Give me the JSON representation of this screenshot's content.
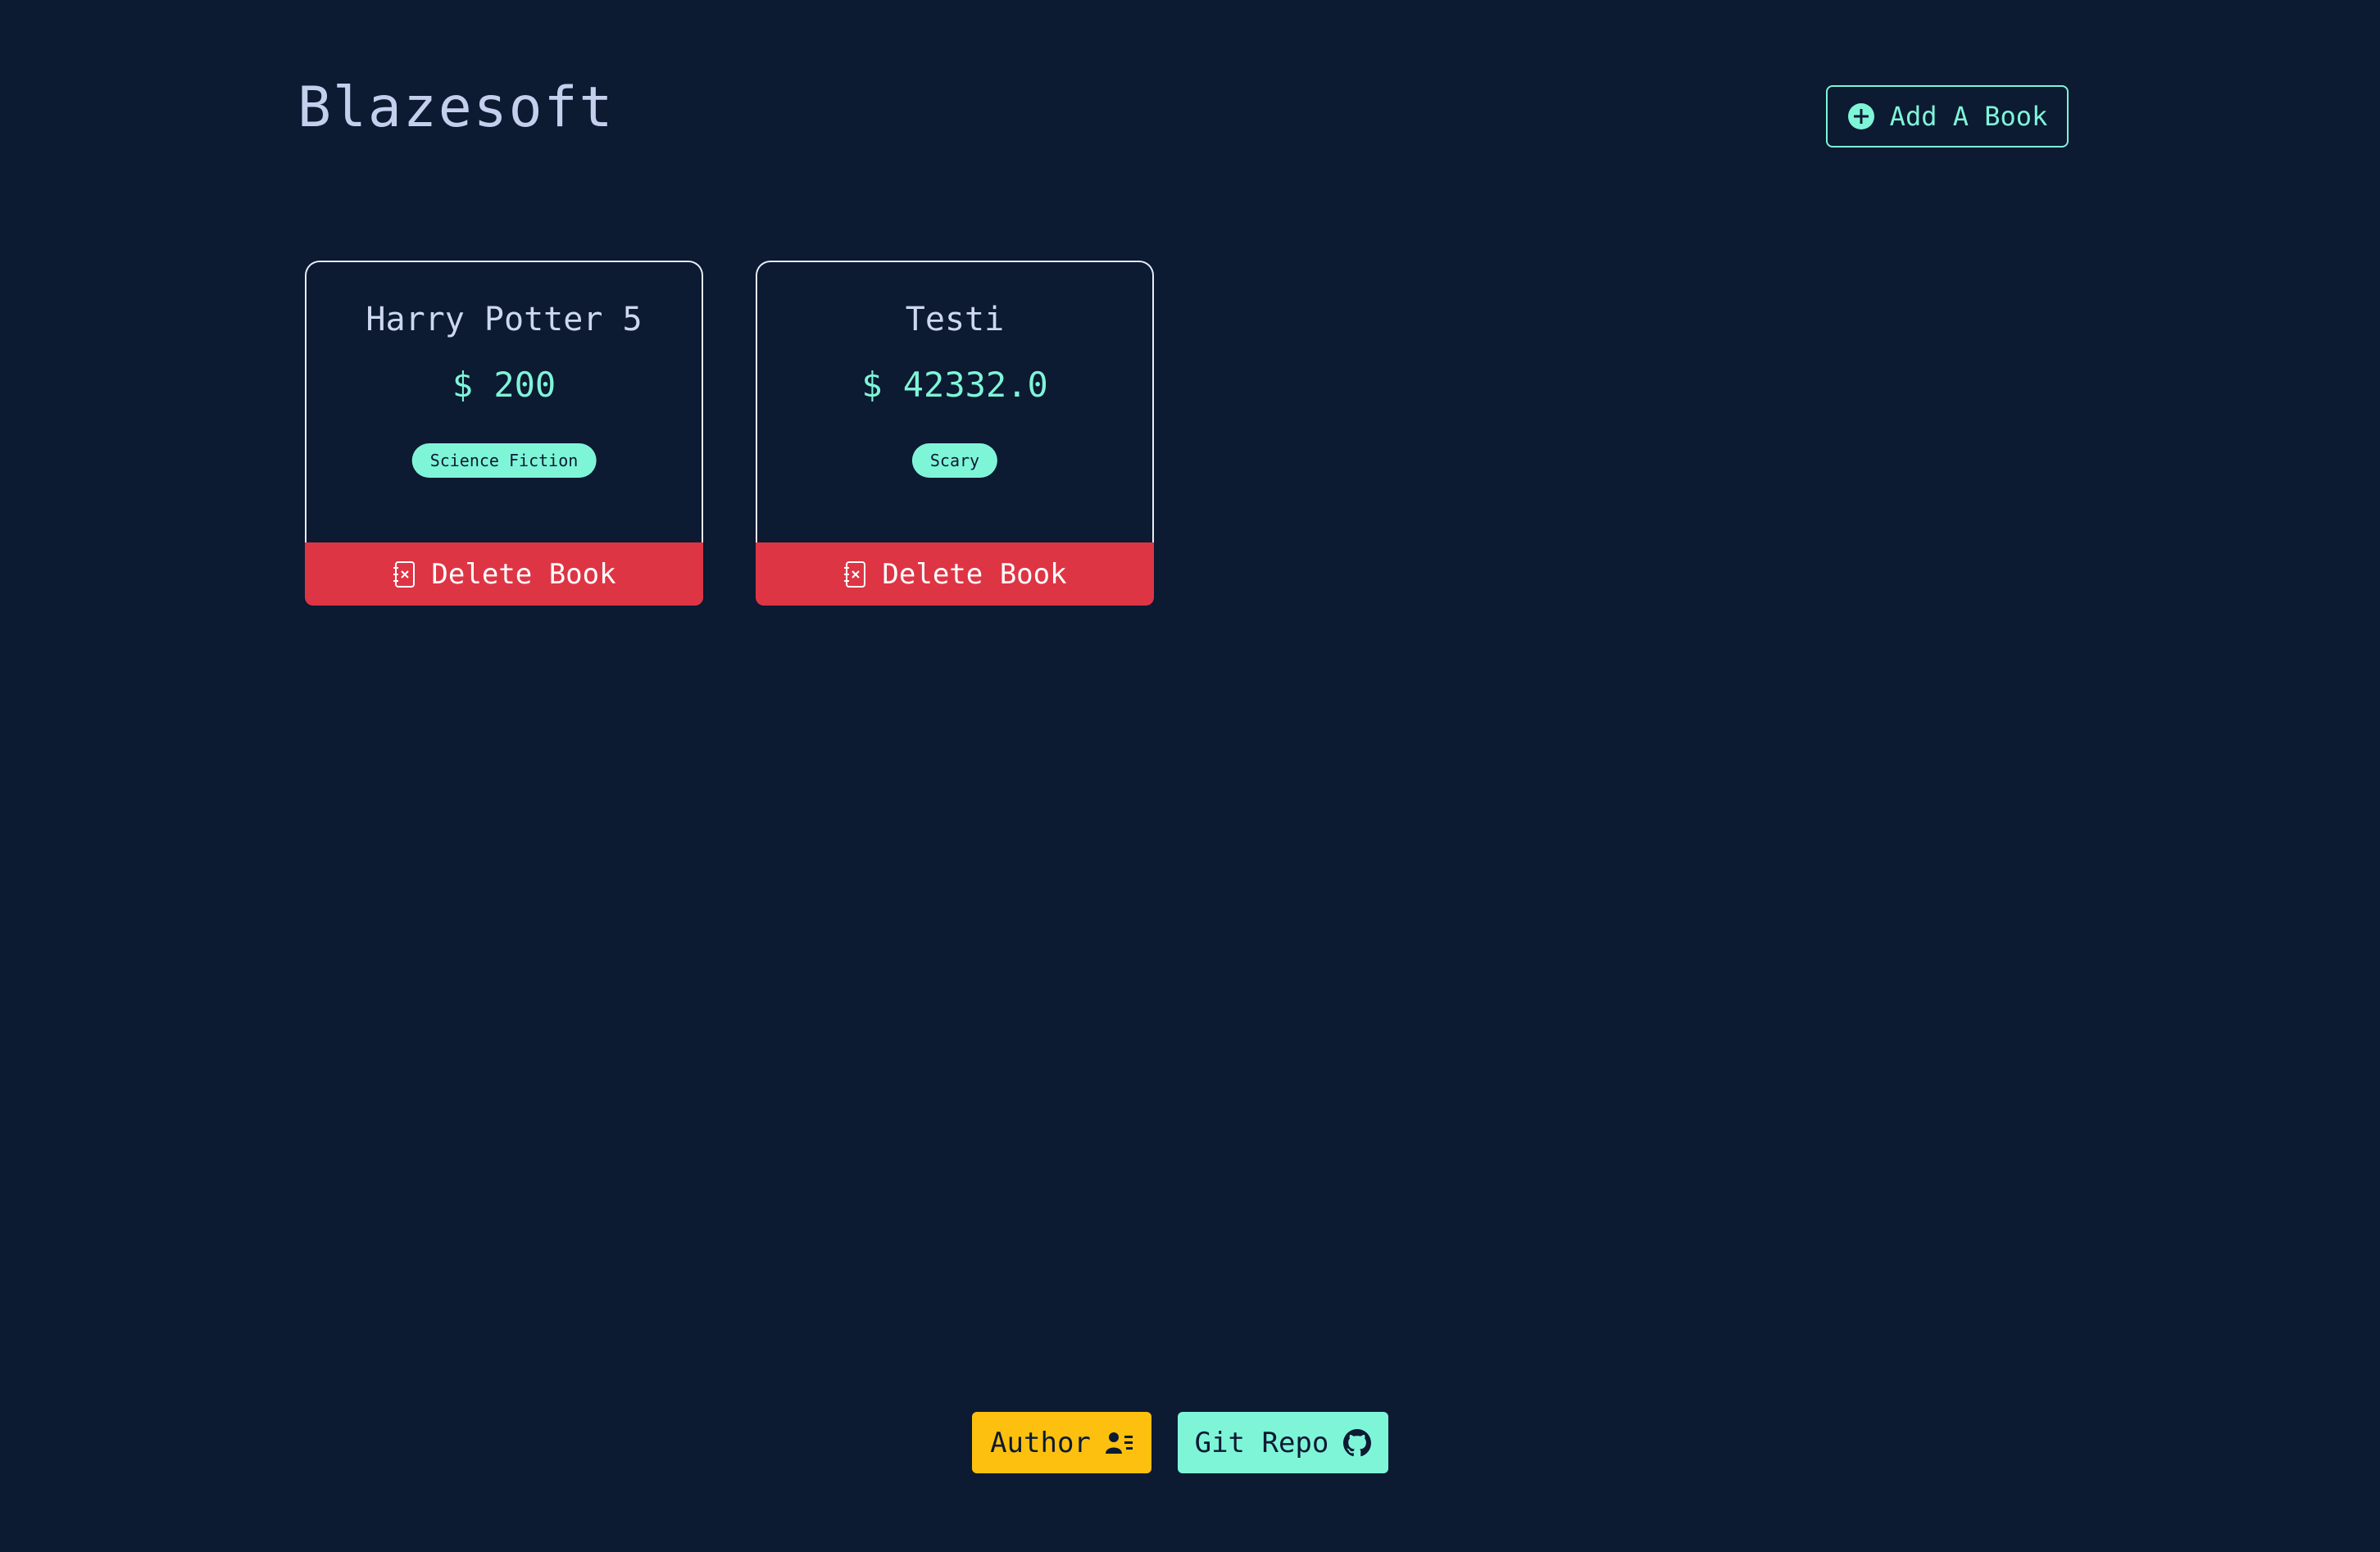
{
  "header": {
    "title": "Blazesoft",
    "add_book_label": "Add A Book"
  },
  "books": [
    {
      "title": "Harry Potter 5",
      "price": "$ 200",
      "genre": "Science Fiction",
      "delete_label": "Delete Book"
    },
    {
      "title": "Testi",
      "price": "$ 42332.0",
      "genre": "Scary",
      "delete_label": "Delete Book"
    }
  ],
  "footer": {
    "author_label": "Author",
    "git_repo_label": "Git Repo"
  },
  "colors": {
    "background": "#0c1a32",
    "accent": "#7ff5d8",
    "danger": "#de3545",
    "warning": "#fdc00f"
  },
  "icons": {
    "add_book": "plus-circle-icon",
    "delete_book": "journal-x-icon",
    "author": "person-lines-icon",
    "git_repo": "github-icon"
  }
}
